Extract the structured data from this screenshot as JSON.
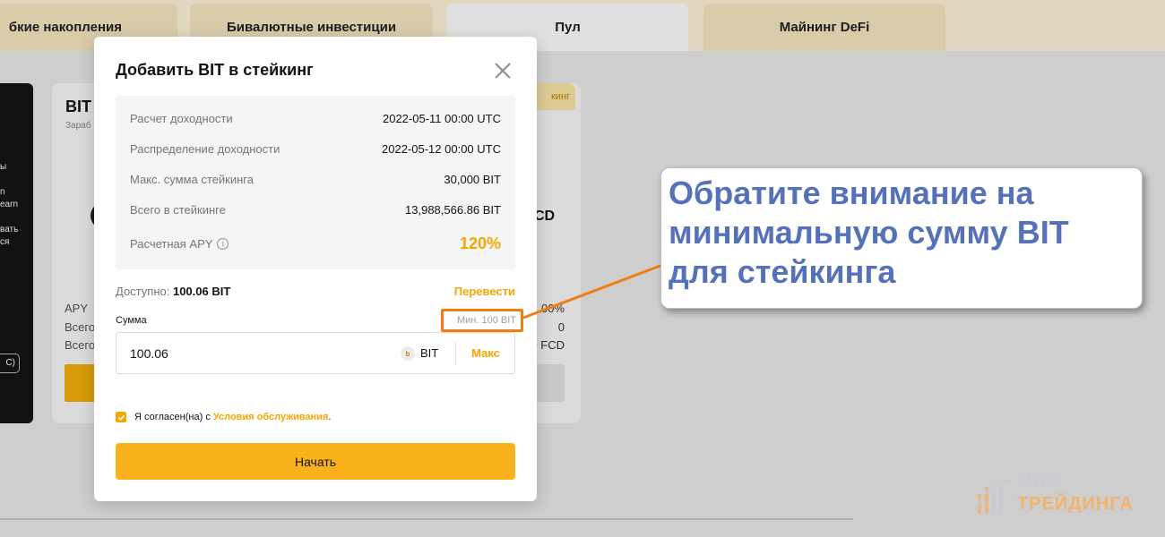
{
  "background": {
    "tabs": [
      {
        "label": "бкие накопления"
      },
      {
        "label": "Бивалютные инвестиции"
      },
      {
        "label": "Пул"
      },
      {
        "label": "Майнинг DeFi"
      }
    ],
    "dark_card_fragments": [
      "ы",
      "n",
      "earn",
      "вать",
      "ся",
      "C)"
    ],
    "pool_card": {
      "title": "BIT",
      "subtitle": "Зараб",
      "badge": "кинг",
      "currency_right": "CD",
      "rows": [
        {
          "label": "APY",
          "value": ".00%"
        },
        {
          "label": "Всего",
          "value": "0"
        },
        {
          "label": "Всего",
          "value": "0 FCD"
        }
      ]
    }
  },
  "modal": {
    "title": "Добавить BIT в стейкинг",
    "info_rows": [
      {
        "label": "Расчет доходности",
        "value": "2022-05-11 00:00 UTC"
      },
      {
        "label": "Распределение доходности",
        "value": "2022-05-12 00:00 UTC"
      },
      {
        "label": "Макс. сумма стейкинга",
        "value": "30,000 BIT"
      },
      {
        "label": "Всего в стейкинге",
        "value": "13,988,566.86 BIT"
      },
      {
        "label": "Расчетная APY",
        "value": "120%",
        "info_icon": "info-icon"
      }
    ],
    "available_label": "Доступно:",
    "available_value": "100.06 BIT",
    "transfer_label": "Перевести",
    "amount_label": "Сумма",
    "min_label": "Мин. 100 BIT",
    "amount_value": "100.06",
    "coin_glyph": "b",
    "unit": "BIT",
    "max_label": "Макс",
    "agree_text": "Я согласен(на) с",
    "terms_label": "Условия обслуживания",
    "agree_suffix": ".",
    "start_label": "Начать"
  },
  "annotation": {
    "callout_text": "Обратите внимание на минимальную сумму BIT для стейкинга",
    "highlight_color": "#f07d12",
    "callout_color": "#5571b8"
  },
  "watermark": {
    "line1": "МИР",
    "line2": "ТРЕЙДИНГА"
  },
  "colors": {
    "accent": "#f7a600",
    "button": "#f9b21c"
  }
}
